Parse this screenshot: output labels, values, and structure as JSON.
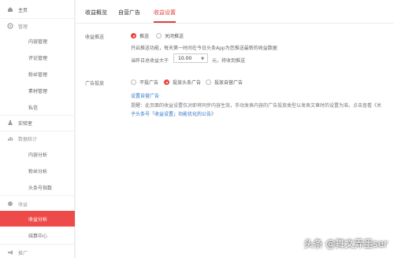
{
  "sidebar": {
    "home": "主页",
    "manage": "管理",
    "content_manage": "内容管理",
    "comment_manage": "评论管理",
    "fans_manage": "粉丝管理",
    "material_manage": "素材管理",
    "private_msg": "私信",
    "lab": "实验室",
    "data_stats": "数据统计",
    "content_analysis": "内容分析",
    "fans_analysis": "粉丝分析",
    "toutiao_index": "头条号指数",
    "earnings": "收益",
    "earnings_analysis": "收益分析",
    "settlement_center": "结算中心",
    "promotion": "推广"
  },
  "tabs": [
    "收益概览",
    "自营广告",
    "收益设置"
  ],
  "active_tab": "收益设置",
  "push": {
    "label": "收益推送",
    "on_label": "推送",
    "off_label": "关闭推送",
    "desc": "开启推送功能，每天第一时间在今日头条App为您推送最新的收益数据",
    "threshold_prefix": "当昨日总收益大于",
    "threshold_value": "10.00",
    "threshold_suffix": "元，将收到推送",
    "selected": "推送"
  },
  "ads": {
    "label": "广告投放",
    "opt1": "不投广告",
    "opt2": "投放头条广告",
    "opt3": "投放自营广告",
    "selected": "投放头条广告",
    "link": "设置自营广告",
    "note_line1": "提醒：此页面的收益设置仅对即将同步内容生效，手动发表内容的广告投放类型以发表文章时的设置为准。点击查看《关",
    "note_link": "子头条号「收益设置」功能优化的公告",
    "note_end": "》"
  },
  "watermark": "头条 @舞文弄墨ser"
}
